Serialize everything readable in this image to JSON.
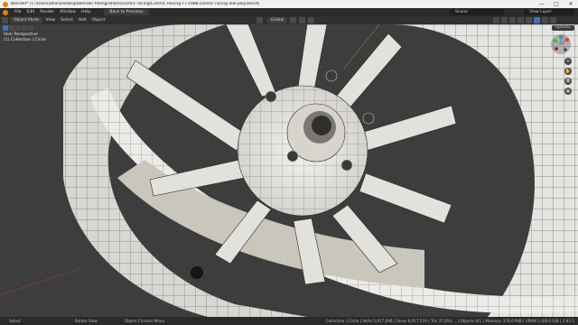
{
  "titlebar": {
    "title": "Blender* [C:\\Users\\ahili\\Desktop\\blender files\\graham\\cosmic racing\\Cosmic Racing FT-1988.cosmic racing low-poly.blend]",
    "min": "—",
    "max": "□",
    "close": "✕"
  },
  "menu": {
    "items": [
      "File",
      "Edit",
      "Render",
      "Window",
      "Help"
    ],
    "workspace_tab": "Back to Previous",
    "scene": "Scene",
    "view_layer": "View Layer"
  },
  "viewport_header": {
    "mode": "Object Mode",
    "menus": [
      "View",
      "Select",
      "Add",
      "Object"
    ],
    "orientation": "Global"
  },
  "overlay": {
    "perspective": "User Perspective",
    "collection": "(1) Collection | Circle",
    "options": "Options"
  },
  "statusbar": {
    "select": "Select",
    "rotate": "Rotate View",
    "context": "Object Context Menu",
    "stats": "Collection | Circle | Verts 5,917,096 | Faces 6,017,519 | Tris 37,054,... | Objects 0/1 | Memory: 378.6 MiB | VRAM 1.4/8.0 GiB | 2.93.1"
  },
  "colors": {
    "accent": "#e87d0d",
    "selected": "#4772b3",
    "viewport_bg": "#3d3d3d",
    "mesh": "#e6e6e4",
    "wire": "#2a2a2a"
  }
}
